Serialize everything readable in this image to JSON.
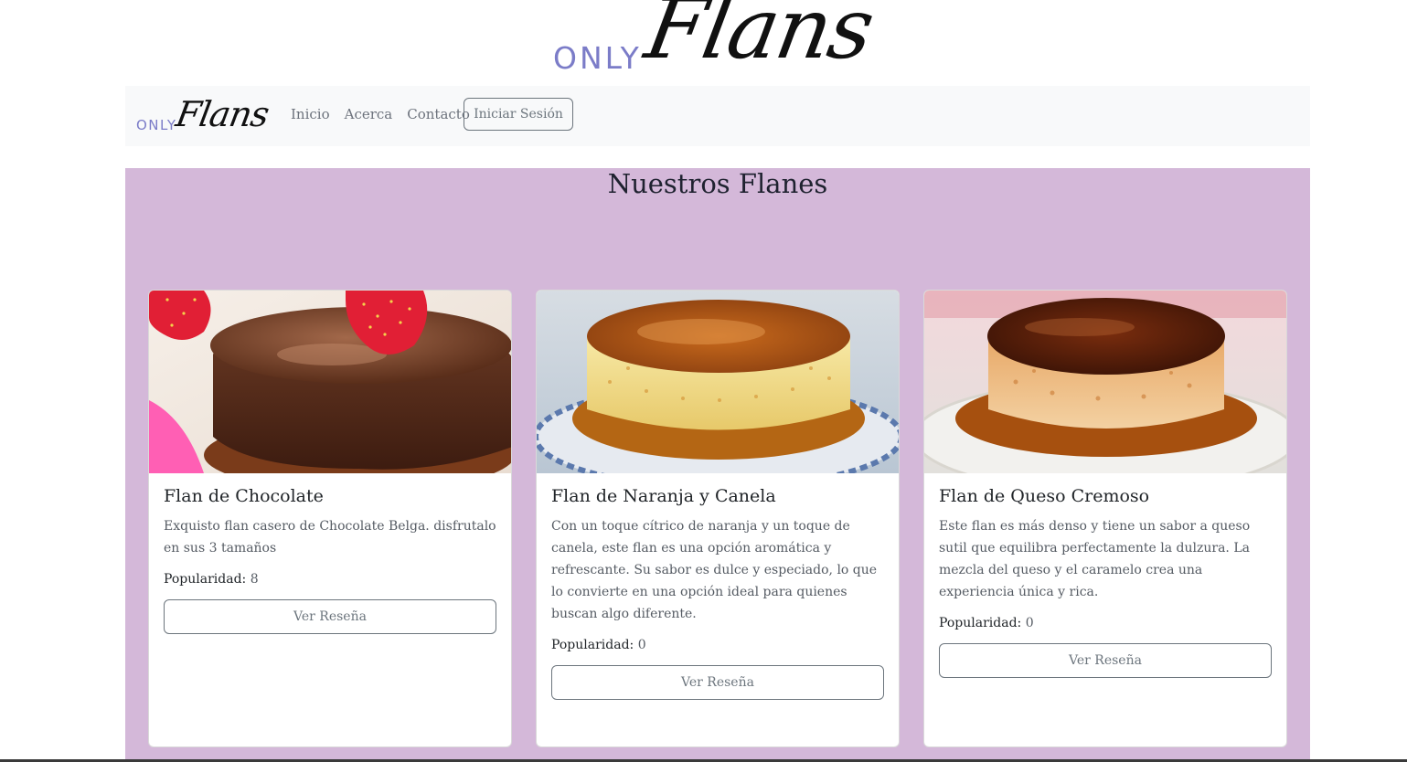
{
  "brand": {
    "only": "ONLY",
    "flans": "Flans"
  },
  "nav": {
    "links": [
      "Inicio",
      "Acerca",
      "Contacto"
    ],
    "login_label": "Iniciar Sesión"
  },
  "main": {
    "title": "Nuestros Flanes",
    "background": "#d4b8d9",
    "cards": [
      {
        "title": "Flan de Chocolate",
        "description": "Exquisto flan casero de Chocolate Belga. disfrutalo en sus 3 tamaños",
        "popularity_label": "Popularidad:",
        "popularity_value": "8",
        "button_label": "Ver Reseña",
        "image": "chocolate-flan-with-strawberries"
      },
      {
        "title": "Flan de Naranja y Canela",
        "description": "Con un toque cítrico de naranja y un toque de canela, este flan es una opción aromática y refrescante. Su sabor es dulce y especiado, lo que lo convierte en una opción ideal para quienes buscan algo diferente.",
        "popularity_label": "Popularidad:",
        "popularity_value": "0",
        "button_label": "Ver Reseña",
        "image": "caramel-flan-on-blue-plate"
      },
      {
        "title": "Flan de Queso Cremoso",
        "description": "Este flan es más denso y tiene un sabor a queso sutil que equilibra perfectamente la dulzura. La mezcla del queso y el caramelo crea una experiencia única y rica.",
        "popularity_label": "Popularidad:",
        "popularity_value": "0",
        "button_label": "Ver Reseña",
        "image": "cheese-flan-on-white-plate"
      }
    ]
  },
  "colors": {
    "brand_only": "#7b7cc8",
    "navbar_bg": "#f8f9fa",
    "button_border": "#6c757d"
  }
}
